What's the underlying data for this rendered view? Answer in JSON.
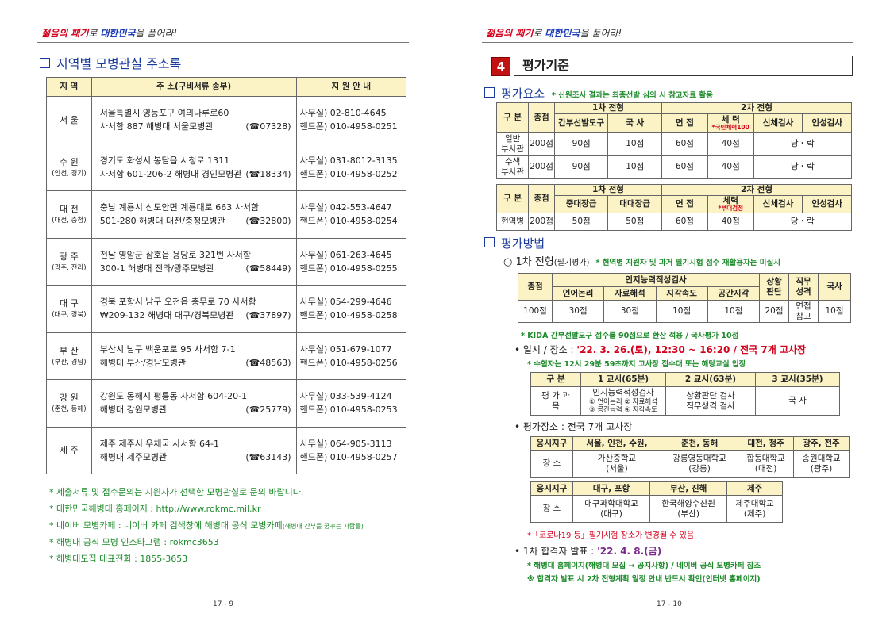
{
  "left": {
    "header": {
      "part1": "젊음의 패기",
      "part2": "로 ",
      "part3": "대한민국",
      "part4": "을 품어라!"
    },
    "section_title": "지역별 모병관실 주소록",
    "table": {
      "headers": [
        "지 역",
        "주 소(구비서류 송부)",
        "지 원 안 내"
      ],
      "rows": [
        {
          "region": "서 울",
          "sub": "",
          "addr1": "서울특별시 영등포구 여의나루로60",
          "addr2": "사서함 887 해병대 서울모병관",
          "zip": "(☎07328)",
          "tel1": "사무실) 02-810-4645",
          "tel2": "핸드폰) 010-4958-0251"
        },
        {
          "region": "수 원",
          "sub": "(인천, 경기)",
          "addr1": "경기도 화성시 봉담읍 시청로 1311",
          "addr2": "사서함 601-206-2 해병대 경인모병관",
          "zip": "(☎18334)",
          "tel1": "사무실) 031-8012-3135",
          "tel2": "핸드폰) 010-4958-0252"
        },
        {
          "region": "대 전",
          "sub": "(대전, 충청)",
          "addr1": "충남 계룡시 신도안면 계룡대로 663 사서함",
          "addr2": "501-280 해병대 대전/충청모병관",
          "zip": "(☎32800)",
          "tel1": "사무실) 042-553-4647",
          "tel2": "핸드폰) 010-4958-0254"
        },
        {
          "region": "광 주",
          "sub": "(광주, 전라)",
          "addr1": "전남 영암군 삼호읍 용당로 321번 사서함",
          "addr2": "300-1 해병대 전라/광주모병관",
          "zip": "(☎58449)",
          "tel1": "사무실) 061-263-4645",
          "tel2": "핸드폰) 010-4958-0255"
        },
        {
          "region": "대 구",
          "sub": "(대구, 경북)",
          "addr1": "경북 포항시 남구 오천읍 충무로 70 사서함",
          "addr2": "₩209-132 해병대 대구/경북모병관",
          "zip": "(☎37897)",
          "tel1": "사무실) 054-299-4646",
          "tel2": "핸드폰) 010-4958-0258"
        },
        {
          "region": "부 산",
          "sub": "(부산, 경남)",
          "addr1": "부산시 남구 백운포로 95 사서함 7-1",
          "addr2": "해병대 부산/경남모병관",
          "zip": "(☎48563)",
          "tel1": "사무실) 051-679-1077",
          "tel2": "핸드폰) 010-4958-0256"
        },
        {
          "region": "강 원",
          "sub": "(춘천, 동해)",
          "addr1": "강원도 동해시 평릉동 사서함 604-20-1",
          "addr2": "해병대 강원모병관",
          "zip": "(☎25779)",
          "tel1": "사무실) 033-539-4124",
          "tel2": "핸드폰) 010-4958-0253"
        },
        {
          "region": "제 주",
          "sub": "",
          "addr1": "제주 제주시 우체국 사서함 64-1",
          "addr2": "해병대 제주모병관",
          "zip": "(☎63143)",
          "tel1": "사무실) 064-905-3113",
          "tel2": "핸드폰) 010-4958-0257"
        }
      ]
    },
    "notes": [
      "* 제출서류 및 접수문의는 지원자가 선택한 모병관실로 문의 바랍니다.",
      "* 대한민국해병대 홈페이지 : http://www.rokmc.mil.kr",
      "* 네이버 모병카페 : 네이버 카페 검색창에 해병대 공식 모병카페",
      "(해병대 간부를 꿈꾸는 사람들)",
      "* 해병대 공식 모병 인스타그램 : rokmc3653",
      "* 해병대모집 대표전화 : 1855-3653"
    ],
    "page_number": "17 - 9"
  },
  "right": {
    "header": {
      "part1": "젊음의 패기",
      "part2": "로 ",
      "part3": "대한민국",
      "part4": "을 품어라!"
    },
    "section_number": "4",
    "section_title": "평가기준",
    "eval_elements": {
      "title": "평가요소",
      "note": "* 신원조사 결과는 최종선발 심의 시 참고자료 활용"
    },
    "table1": {
      "h_gubun": "구 분",
      "h_total": "총점",
      "h_phase1": "1차 전형",
      "h_phase2": "2차 전형",
      "cols": [
        "간부선발도구",
        "국 사",
        "면 접",
        "체 력",
        "*국민체력100",
        "신체검사",
        "인성검사"
      ],
      "rows": [
        {
          "label1": "일반",
          "label2": "부사관",
          "total": "200점",
          "v": [
            "90점",
            "10점",
            "60점",
            "40점"
          ],
          "pf": "당・락"
        },
        {
          "label1": "수색",
          "label2": "부사관",
          "total": "200점",
          "v": [
            "90점",
            "10점",
            "60점",
            "40점"
          ],
          "pf": "당・락"
        }
      ]
    },
    "table2": {
      "h_gubun": "구 분",
      "h_total": "총점",
      "h_phase1": "1차 전형",
      "h_phase2": "2차 전형",
      "cols": [
        "중대장급",
        "대대장급",
        "면 접",
        "체력",
        "*부대검정",
        "신체검사",
        "인성검사"
      ],
      "row": {
        "label": "현역병",
        "total": "200점",
        "v": [
          "50점",
          "50점",
          "60점",
          "40점"
        ],
        "pf": "당・락"
      }
    },
    "eval_method": {
      "title": "평가방법"
    },
    "phase1": {
      "label": "1차 전형",
      "label_sub": "(필기평가)",
      "note": "* 현역병 지원자 및 과거 필기시험 점수 재활용자는 미실시"
    },
    "table3": {
      "h_total": "총점",
      "h_cog": "인지능력적성검사",
      "cog_cols": [
        "언어논리",
        "자료해석",
        "지각속도",
        "공간지각"
      ],
      "h_sit": "상황판단",
      "h_duty": "직무성격",
      "h_hist": "국사",
      "vals": [
        "100점",
        "30점",
        "30점",
        "10점",
        "10점",
        "20점",
        "면접참고",
        "10점"
      ]
    },
    "kida_note": "* KIDA 간부선발도구 점수를 90점으로 환산 적용 / 국사평가 10점",
    "schedule": {
      "label": "• 일시 / 장소 : ",
      "value": "'22. 3. 26.(토), 12:30 ~ 16:20 / 전국 7개 고사장"
    },
    "entry_note": "* 수험자는 12시 29분 59초까지 고사장 접수대 또는 해당교실 입장",
    "table4": {
      "headers": [
        "구 분",
        "1 교시(65분)",
        "2 교시(63분)",
        "3 교시(35분)"
      ],
      "label": "평 가 과 목",
      "p1_main": "인지능력적성검사",
      "p1_sub1": "① 언어논리 ② 자료해석",
      "p1_sub2": "③ 공간능력 ④ 지각속도",
      "p2_line1": "상황판단 검사",
      "p2_line2": "직무성격 검사",
      "p3": "국 사"
    },
    "venue_label": "• 평가장소 : 전국 7개 고사장",
    "table5": {
      "h": "응시지구",
      "districts": [
        "서울, 인천, 수원,",
        "춘천, 동해",
        "대전, 청주",
        "광주, 전주"
      ],
      "label": "장 소",
      "venues": [
        [
          "가산중학교",
          "(서울)"
        ],
        [
          "강릉영동대학교",
          "(강릉)"
        ],
        [
          "합동대학교",
          "(대전)"
        ],
        [
          "송원대학교",
          "(광주)"
        ]
      ]
    },
    "table6": {
      "h": "응시지구",
      "districts": [
        "대구, 포항",
        "부산, 진해",
        "제주"
      ],
      "label": "장 소",
      "venues": [
        [
          "대구과학대학교",
          "(대구)"
        ],
        [
          "한국해양수산원",
          "(부산)"
        ],
        [
          "제주대학교",
          "(제주)"
        ]
      ]
    },
    "covid_note": "*「코로나19 등」필기시험 장소가 변경될 수 있음.",
    "announce": {
      "label": "• 1차 합격자 발표 : ",
      "value": "'22. 4. 8.(금)"
    },
    "announce_note1": "* 해병대 홈페이지(해병대 모집 → 공지사항) / 네이버 공식 모병카페 참조",
    "announce_note2": "※ 합격자 발표 시 2차 전형계획 일정 안내 반드시 확인(인터넷 홈페이지)",
    "page_number": "17 - 10"
  }
}
